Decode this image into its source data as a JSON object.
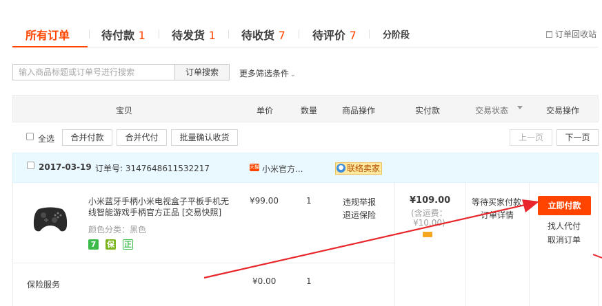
{
  "tabs": [
    {
      "label": "所有订单",
      "count": ""
    },
    {
      "label": "待付款",
      "count": "1"
    },
    {
      "label": "待发货",
      "count": "1"
    },
    {
      "label": "待收货",
      "count": "7"
    },
    {
      "label": "待评价",
      "count": "7"
    },
    {
      "label": "分阶段",
      "count": ""
    }
  ],
  "recycle_bin": "订单回收站",
  "search": {
    "placeholder": "输入商品标题或订单号进行搜索",
    "button": "订单搜索",
    "more_filters": "更多筛选条件"
  },
  "table_header": {
    "item": "宝贝",
    "unit_price": "单价",
    "quantity": "数量",
    "item_ops": "商品操作",
    "paid": "实付款",
    "status": "交易状态",
    "ops": "交易操作"
  },
  "bulk": {
    "select_all": "全选",
    "merge_pay": "合并付款",
    "merge_proxy": "合并代付",
    "batch_confirm": "批量确认收货",
    "prev_page": "上一页",
    "next_page": "下一页"
  },
  "order": {
    "date": "2017-03-19",
    "order_no_label": "订单号:",
    "order_no": "3147648611532217",
    "shop_icon": "天猫",
    "shop_name": "小米官方...",
    "contact_seller": "联络卖家",
    "item": {
      "title": "小米蓝牙手柄小米电视盒子平板手机无线智能游戏手柄官方正品 [交易快照]",
      "sku": "颜色分类：黑色",
      "badges": [
        "7",
        "保",
        "正"
      ],
      "price": "¥99.00",
      "qty": "1",
      "op_report": "违规举报",
      "op_insurance": "退运保险"
    },
    "service": {
      "name": "保险服务",
      "price": "¥0.00",
      "qty": "1"
    },
    "total": "¥109.00",
    "shipping_line1": "(含运费：",
    "shipping_line2": "¥10.00)",
    "status": "等待买家付款",
    "status_detail": "订单详情",
    "pay_now": "立即付款",
    "proxy_pay": "找人代付",
    "cancel": "取消订单"
  },
  "colors": {
    "accent": "#ff4400",
    "arrow": "#e8262b",
    "header_bg": "#f5f5f5",
    "order_head_bg": "#eaf8ff"
  },
  "icons": [
    "trash-icon",
    "caret-down-icon",
    "checkbox-icon",
    "tmall-icon",
    "chat-icon",
    "phone-icon",
    "gamepad-image"
  ]
}
